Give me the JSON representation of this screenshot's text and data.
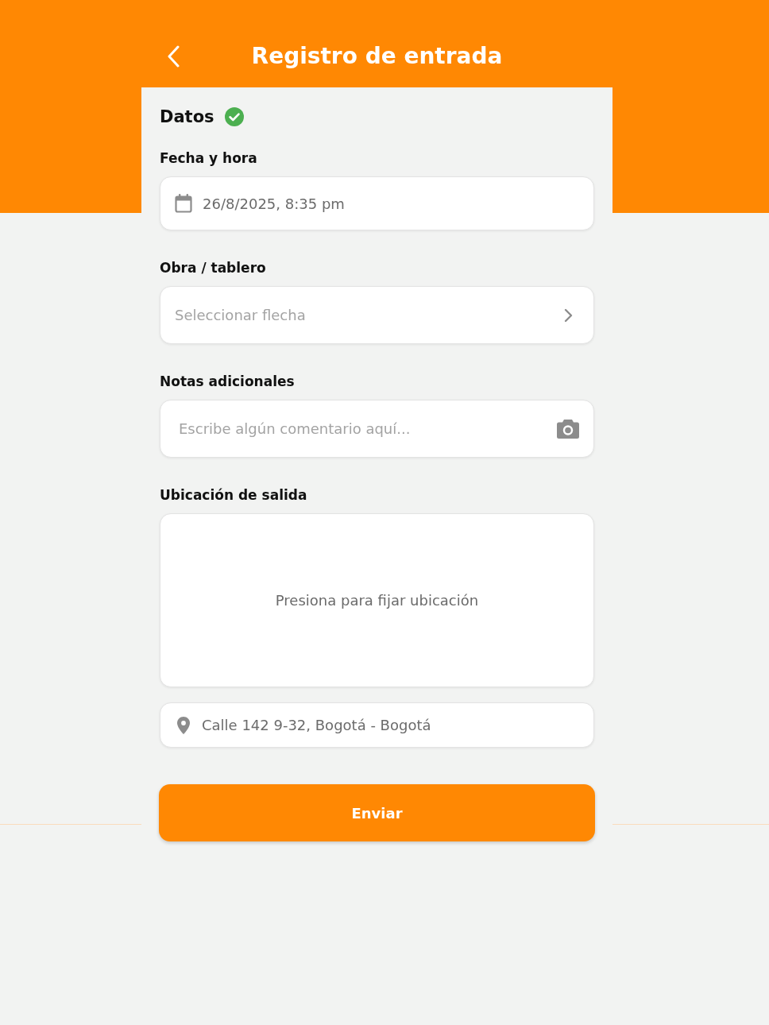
{
  "header": {
    "title": "Registro de entrada"
  },
  "section": {
    "title": "Datos",
    "complete": true
  },
  "fields": [
    {
      "kind": "date",
      "label": "Fecha y hora",
      "value": "26/8/2025, 8:35 pm"
    },
    {
      "kind": "select",
      "label": "Obra / tablero",
      "placeholder": "Seleccionar flecha"
    },
    {
      "kind": "notes",
      "label": "Notas adicionales",
      "placeholder": "Escribe algún comentario aquí..."
    },
    {
      "kind": "location",
      "label": "Ubicación de salida",
      "map_hint": "Presiona para fijar ubicación",
      "address": "Calle 142 9-32, Bogotá - Bogotá"
    }
  ],
  "submit": {
    "label": "Enviar"
  }
}
